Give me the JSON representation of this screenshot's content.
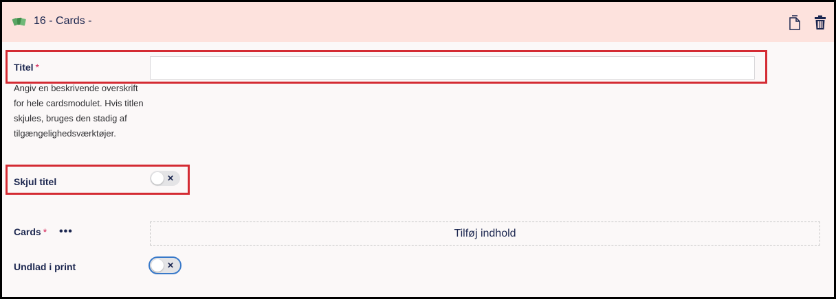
{
  "header": {
    "title": "16 - Cards -",
    "icon": "cards-icon",
    "actions": [
      "copy-icon",
      "trash-icon"
    ]
  },
  "fields": {
    "titel": {
      "label": "Titel",
      "required_marker": "*",
      "value": "",
      "help": "Angiv en beskrivende overskrift for hele cardsmodulet. Hvis titlen skjules, bruges den stadig af tilgængelighedsværktøjer."
    },
    "skjul_titel": {
      "label": "Skjul titel",
      "toggle_state": "off",
      "toggle_glyph": "✕"
    },
    "cards": {
      "label": "Cards",
      "required_marker": "*",
      "menu": "•••",
      "add_label": "Tilføj indhold"
    },
    "undlad_print": {
      "label": "Undlad i print",
      "toggle_state": "off",
      "toggle_glyph": "✕"
    }
  },
  "colors": {
    "header_bg": "#fde2dd",
    "highlight": "#d42b33",
    "required": "#d42054",
    "text": "#1b264f",
    "focus": "#3879c9"
  }
}
